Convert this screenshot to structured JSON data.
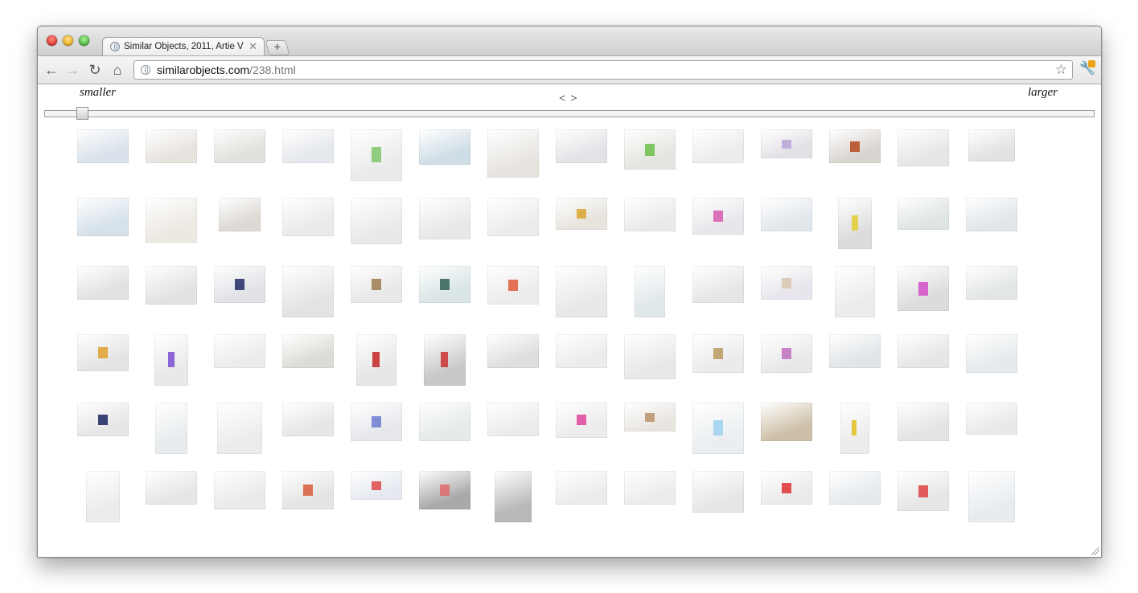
{
  "browser": {
    "tab_title": "Similar Objects, 2011, Artie V",
    "tab_close": "✕",
    "new_tab": "+",
    "url_host": "similarobjects.com",
    "url_path": "/238.html",
    "icons": [
      "back-arrow-icon",
      "forward-arrow-icon",
      "reload-icon",
      "home-icon",
      "globe-icon",
      "star-icon",
      "wrench-icon"
    ]
  },
  "page": {
    "smaller_label": "smaller",
    "larger_label": "larger",
    "prev_next": "< >",
    "slider_value": 0.03
  },
  "gallery": {
    "rows": 6,
    "cols": 14,
    "thumbnails": [
      [
        {
          "w": 64,
          "h": 42,
          "c": "#d9e2ea"
        },
        {
          "w": 64,
          "h": 42,
          "c": "#e7e3df"
        },
        {
          "w": 64,
          "h": 42,
          "c": "#e2e0dc"
        },
        {
          "w": 64,
          "h": 42,
          "c": "#e5e8ec"
        },
        {
          "w": 64,
          "h": 64,
          "c": "#e9ecea"
        },
        {
          "w": 64,
          "h": 44,
          "c": "#cfdde6"
        },
        {
          "w": 64,
          "h": 60,
          "c": "#e7e4e0"
        },
        {
          "w": 64,
          "h": 42,
          "c": "#e1e3e6"
        },
        {
          "w": 64,
          "h": 50,
          "c": "#e3e6e0"
        },
        {
          "w": 64,
          "h": 42,
          "c": "#ececec"
        },
        {
          "w": 64,
          "h": 36,
          "c": "#e4e1e6"
        },
        {
          "w": 64,
          "h": 42,
          "c": "#d9d4cf"
        },
        {
          "w": 64,
          "h": 46,
          "c": "#e6e6e6"
        },
        {
          "w": 58,
          "h": 40,
          "c": "#e2e2e2"
        }
      ],
      [
        {
          "w": 64,
          "h": 48,
          "c": "#d6e1ea"
        },
        {
          "w": 64,
          "h": 56,
          "c": "#ece8e2"
        },
        {
          "w": 52,
          "h": 42,
          "c": "#ddd9d4"
        },
        {
          "w": 64,
          "h": 48,
          "c": "#ebeaea"
        },
        {
          "w": 64,
          "h": 58,
          "c": "#e8e9ea"
        },
        {
          "w": 64,
          "h": 52,
          "c": "#e8e8e8"
        },
        {
          "w": 64,
          "h": 48,
          "c": "#ececec"
        },
        {
          "w": 64,
          "h": 40,
          "c": "#e7e4dd"
        },
        {
          "w": 64,
          "h": 42,
          "c": "#eaeaea"
        },
        {
          "w": 64,
          "h": 46,
          "c": "#e8e6ea"
        },
        {
          "w": 64,
          "h": 42,
          "c": "#e2e7ec"
        },
        {
          "w": 42,
          "h": 64,
          "c": "#dcdcdc"
        },
        {
          "w": 64,
          "h": 40,
          "c": "#dfe5e0"
        },
        {
          "w": 64,
          "h": 42,
          "c": "#e0e6ea"
        }
      ],
      [
        {
          "w": 64,
          "h": 42,
          "c": "#dfe1e3"
        },
        {
          "w": 64,
          "h": 48,
          "c": "#e2e2e2"
        },
        {
          "w": 64,
          "h": 46,
          "c": "#e0e2e6"
        },
        {
          "w": 64,
          "h": 64,
          "c": "#e3e3e3"
        },
        {
          "w": 64,
          "h": 46,
          "c": "#e8e8e8"
        },
        {
          "w": 64,
          "h": 46,
          "c": "#d9e5e6"
        },
        {
          "w": 64,
          "h": 48,
          "c": "#ececec"
        },
        {
          "w": 64,
          "h": 64,
          "c": "#e8e8e8"
        },
        {
          "w": 38,
          "h": 64,
          "c": "#e1e8ea"
        },
        {
          "w": 64,
          "h": 46,
          "c": "#e6e6e6"
        },
        {
          "w": 64,
          "h": 42,
          "c": "#e8e6ec"
        },
        {
          "w": 50,
          "h": 64,
          "c": "#ececec"
        },
        {
          "w": 64,
          "h": 56,
          "c": "#dcdcdc"
        },
        {
          "w": 64,
          "h": 42,
          "c": "#e3e6e6"
        }
      ],
      [
        {
          "w": 64,
          "h": 46,
          "c": "#e4e4e4"
        },
        {
          "w": 42,
          "h": 64,
          "c": "#e9e9e9"
        },
        {
          "w": 64,
          "h": 42,
          "c": "#ececec"
        },
        {
          "w": 64,
          "h": 42,
          "c": "#dcdcd6"
        },
        {
          "w": 50,
          "h": 64,
          "c": "#e6e6e6"
        },
        {
          "w": 52,
          "h": 64,
          "c": "#c8c8c8"
        },
        {
          "w": 64,
          "h": 42,
          "c": "#dedede"
        },
        {
          "w": 64,
          "h": 42,
          "c": "#ececec"
        },
        {
          "w": 64,
          "h": 56,
          "c": "#e8e8e8"
        },
        {
          "w": 64,
          "h": 48,
          "c": "#ebebeb"
        },
        {
          "w": 64,
          "h": 48,
          "c": "#e8e8e8"
        },
        {
          "w": 64,
          "h": 42,
          "c": "#e1e5e8"
        },
        {
          "w": 64,
          "h": 42,
          "c": "#e6e6e6"
        },
        {
          "w": 64,
          "h": 48,
          "c": "#e6eaec"
        }
      ],
      [
        {
          "w": 64,
          "h": 42,
          "c": "#e6e6e6"
        },
        {
          "w": 40,
          "h": 64,
          "c": "#e8ecee"
        },
        {
          "w": 56,
          "h": 64,
          "c": "#ececec"
        },
        {
          "w": 64,
          "h": 42,
          "c": "#e6e6e6"
        },
        {
          "w": 64,
          "h": 48,
          "c": "#e6e8ec"
        },
        {
          "w": 64,
          "h": 48,
          "c": "#e6eaea"
        },
        {
          "w": 64,
          "h": 42,
          "c": "#ececec"
        },
        {
          "w": 64,
          "h": 44,
          "c": "#ececec"
        },
        {
          "w": 64,
          "h": 36,
          "c": "#e9e6e2"
        },
        {
          "w": 64,
          "h": 64,
          "c": "#eaeef0"
        },
        {
          "w": 64,
          "h": 48,
          "c": "#cdbfa7"
        },
        {
          "w": 36,
          "h": 64,
          "c": "#ececec"
        },
        {
          "w": 64,
          "h": 48,
          "c": "#e4e4e4"
        },
        {
          "w": 64,
          "h": 40,
          "c": "#e9e9e9"
        }
      ],
      [
        {
          "w": 42,
          "h": 64,
          "c": "#ececec"
        },
        {
          "w": 64,
          "h": 42,
          "c": "#e6e6e6"
        },
        {
          "w": 64,
          "h": 48,
          "c": "#e8eaec"
        },
        {
          "w": 64,
          "h": 48,
          "c": "#e4e4e4"
        },
        {
          "w": 64,
          "h": 36,
          "c": "#e6eaf0"
        },
        {
          "w": 64,
          "h": 48,
          "c": "#a9a9a9"
        },
        {
          "w": 46,
          "h": 64,
          "c": "#b9b9b9"
        },
        {
          "w": 64,
          "h": 42,
          "c": "#ececec"
        },
        {
          "w": 64,
          "h": 42,
          "c": "#ececec"
        },
        {
          "w": 64,
          "h": 52,
          "c": "#e4e6e8"
        },
        {
          "w": 64,
          "h": 42,
          "c": "#ebebeb"
        },
        {
          "w": 64,
          "h": 42,
          "c": "#e6eaee"
        },
        {
          "w": 64,
          "h": 50,
          "c": "#e6e6e6"
        },
        {
          "w": 58,
          "h": 64,
          "c": "#e8ecf0"
        }
      ]
    ],
    "accents": [
      [
        null,
        null,
        null,
        null,
        "#7fc46a",
        null,
        null,
        null,
        "#6cc04a",
        null,
        "#b9a6d8",
        "#b5491c",
        null,
        null
      ],
      [
        null,
        null,
        null,
        null,
        null,
        null,
        null,
        "#d8a530",
        null,
        "#d35ab0",
        null,
        "#e0cc30",
        null,
        null
      ],
      [
        null,
        null,
        "#1f2a66",
        null,
        "#9c7a50",
        "#2f5f55",
        "#e05a3a",
        null,
        null,
        null,
        "#d7c7b0",
        null,
        "#d24fc6",
        null
      ],
      [
        "#e0a030",
        "#7b4fd0",
        null,
        null,
        "#c42424",
        "#cc3333",
        null,
        null,
        null,
        "#b89a60",
        "#c06fc0",
        null,
        null,
        null
      ],
      [
        "#1b2460",
        null,
        null,
        null,
        "#6d7bd0",
        null,
        null,
        "#e0449e",
        "#b9926a",
        "#9ed0f0",
        null,
        "#e0c020",
        null,
        null
      ],
      [
        null,
        null,
        null,
        "#d85a3a",
        "#e04a4a",
        "#e06a6a",
        null,
        null,
        null,
        null,
        "#e03030",
        null,
        "#e04040",
        null
      ]
    ]
  },
  "colors": {
    "link_host": "#111111",
    "link_path": "#777777"
  }
}
